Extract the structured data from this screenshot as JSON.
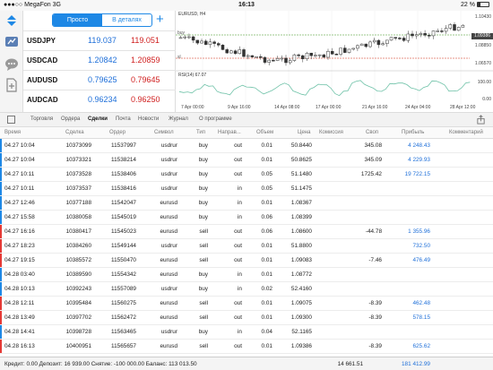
{
  "status_bar": {
    "carrier": "MegaFon",
    "network": "3G",
    "time": "16:13",
    "battery": "22 %"
  },
  "quotes": {
    "mode_simple": "Просто",
    "mode_detailed": "В деталях",
    "add_label": "+",
    "rows": [
      {
        "symbol": "USDJPY",
        "bid": "119.037",
        "ask": "119.051"
      },
      {
        "symbol": "USDCAD",
        "bid": "1.20842",
        "ask": "1.20859"
      },
      {
        "symbol": "AUDUSD",
        "bid": "0.79625",
        "ask": "0.79645"
      },
      {
        "symbol": "AUDCAD",
        "bid": "0.96234",
        "ask": "0.96250"
      }
    ]
  },
  "chart": {
    "title": "EURUSD, H4",
    "buy_label": "buy",
    "sell_label": "sl",
    "current_price": "1.09386",
    "price_axis": [
      "1.10430",
      "1.08850",
      "1.06570"
    ],
    "rsi_label": "RSI(14) 67.07",
    "rsi_axis": [
      "100.00",
      "0.00"
    ],
    "time_axis": [
      "7 Apr 00:00",
      "9 Apr 16:00",
      "14 Apr 08:00",
      "17 Apr 00:00",
      "21 Apr 16:00",
      "24 Apr 04:00",
      "28 Apr 12:00"
    ],
    "colors": {
      "up": "#ffffff",
      "down": "#333333",
      "rsi_line": "#6fc2a8",
      "buy_line": "#7db66a",
      "sell_line": "#e07060"
    }
  },
  "tabs": {
    "items": [
      "Торговля",
      "Ордера",
      "Сделки",
      "Почта",
      "Новости",
      "Журнал",
      "О программе"
    ],
    "active": "Сделки"
  },
  "table": {
    "headers": [
      "Время",
      "Сделка",
      "Ордер",
      "Символ",
      "Тип",
      "Направ...",
      "Объем",
      "Цена",
      "Комиссия",
      "Своп",
      "Прибыль",
      "Комментарий"
    ],
    "rows": [
      {
        "time": "04.27 10:04",
        "deal": "10373099",
        "order": "11537997",
        "symbol": "usdrur",
        "type": "buy",
        "dir": "out",
        "vol": "0.01",
        "price": "50.8440",
        "comm": "",
        "swap": "345.08",
        "profit": "4 248.43"
      },
      {
        "time": "04.27 10:04",
        "deal": "10373321",
        "order": "11538214",
        "symbol": "usdrur",
        "type": "buy",
        "dir": "out",
        "vol": "0.01",
        "price": "50.8625",
        "comm": "",
        "swap": "345.09",
        "profit": "4 229.93"
      },
      {
        "time": "04.27 10:11",
        "deal": "10373528",
        "order": "11538406",
        "symbol": "usdrur",
        "type": "buy",
        "dir": "out",
        "vol": "0.05",
        "price": "51.1480",
        "comm": "",
        "swap": "1725.42",
        "profit": "19 722.15"
      },
      {
        "time": "04.27 10:11",
        "deal": "10373537",
        "order": "11538416",
        "symbol": "usdrur",
        "type": "buy",
        "dir": "in",
        "vol": "0.05",
        "price": "51.1475",
        "comm": "",
        "swap": "",
        "profit": ""
      },
      {
        "time": "04.27 12:46",
        "deal": "10377188",
        "order": "11542047",
        "symbol": "eurusd",
        "type": "buy",
        "dir": "in",
        "vol": "0.01",
        "price": "1.08367",
        "comm": "",
        "swap": "",
        "profit": ""
      },
      {
        "time": "04.27 15:58",
        "deal": "10380058",
        "order": "11545019",
        "symbol": "eurusd",
        "type": "buy",
        "dir": "in",
        "vol": "0.06",
        "price": "1.08399",
        "comm": "",
        "swap": "",
        "profit": ""
      },
      {
        "time": "04.27 16:16",
        "deal": "10380417",
        "order": "11545023",
        "symbol": "eurusd",
        "type": "sell",
        "dir": "out",
        "vol": "0.06",
        "price": "1.08600",
        "comm": "",
        "swap": "-44.78",
        "profit": "1 355.96"
      },
      {
        "time": "04.27 18:23",
        "deal": "10384260",
        "order": "11549144",
        "symbol": "usdrur",
        "type": "sell",
        "dir": "out",
        "vol": "0.01",
        "price": "51.8800",
        "comm": "",
        "swap": "",
        "profit": "732.50"
      },
      {
        "time": "04.27 19:15",
        "deal": "10385572",
        "order": "11550470",
        "symbol": "eurusd",
        "type": "sell",
        "dir": "out",
        "vol": "0.01",
        "price": "1.09083",
        "comm": "",
        "swap": "-7.46",
        "profit": "476.49"
      },
      {
        "time": "04.28 03:40",
        "deal": "10389590",
        "order": "11554342",
        "symbol": "eurusd",
        "type": "buy",
        "dir": "in",
        "vol": "0.01",
        "price": "1.08772",
        "comm": "",
        "swap": "",
        "profit": ""
      },
      {
        "time": "04.28 10:13",
        "deal": "10392243",
        "order": "11557089",
        "symbol": "usdrur",
        "type": "buy",
        "dir": "in",
        "vol": "0.02",
        "price": "52.4160",
        "comm": "",
        "swap": "",
        "profit": ""
      },
      {
        "time": "04.28 12:11",
        "deal": "10395484",
        "order": "11560275",
        "symbol": "eurusd",
        "type": "sell",
        "dir": "out",
        "vol": "0.01",
        "price": "1.09075",
        "comm": "",
        "swap": "-8.39",
        "profit": "462.48"
      },
      {
        "time": "04.28 13:49",
        "deal": "10397702",
        "order": "11562472",
        "symbol": "eurusd",
        "type": "sell",
        "dir": "out",
        "vol": "0.01",
        "price": "1.09300",
        "comm": "",
        "swap": "-8.39",
        "profit": "578.15"
      },
      {
        "time": "04.28 14:41",
        "deal": "10398728",
        "order": "11563465",
        "symbol": "usdrur",
        "type": "buy",
        "dir": "in",
        "vol": "0.04",
        "price": "52.1165",
        "comm": "",
        "swap": "",
        "profit": ""
      },
      {
        "time": "04.28 16:13",
        "deal": "10400951",
        "order": "11565657",
        "symbol": "eurusd",
        "type": "sell",
        "dir": "out",
        "vol": "0.01",
        "price": "1.09386",
        "comm": "",
        "swap": "-8.39",
        "profit": "625.62"
      }
    ]
  },
  "footer": {
    "summary": "Кредит: 0.00 Депозит: 16 939.00 Снятие: -100 000.00 Баланс: 113 013.50",
    "swap_total": "14 661.51",
    "profit_total": "181 412.99"
  }
}
